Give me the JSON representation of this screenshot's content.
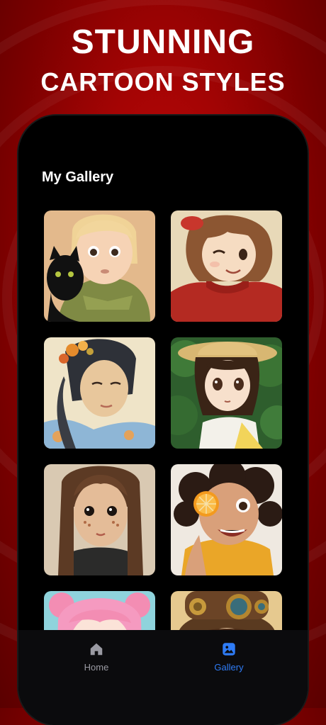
{
  "headline": {
    "line1": "STUNNING",
    "line2": "CARTOON STYLES"
  },
  "gallery": {
    "title": "My Gallery",
    "items": [
      {
        "style": "3d-cartoon-girl-with-black-cat"
      },
      {
        "style": "anime-girl-red-sweater-winking"
      },
      {
        "style": "watercolor-woman-with-flowers"
      },
      {
        "style": "anime-girl-straw-hat"
      },
      {
        "style": "knitted-doll"
      },
      {
        "style": "3d-cartoon-girl-orange-slice"
      },
      {
        "style": "pink-hair-anime-girl"
      },
      {
        "style": "steampunk-goggles-character"
      }
    ]
  },
  "tabbar": {
    "home_label": "Home",
    "gallery_label": "Gallery",
    "active": "Gallery",
    "active_color": "#2f7cf6",
    "inactive_color": "#9a9aa2"
  }
}
